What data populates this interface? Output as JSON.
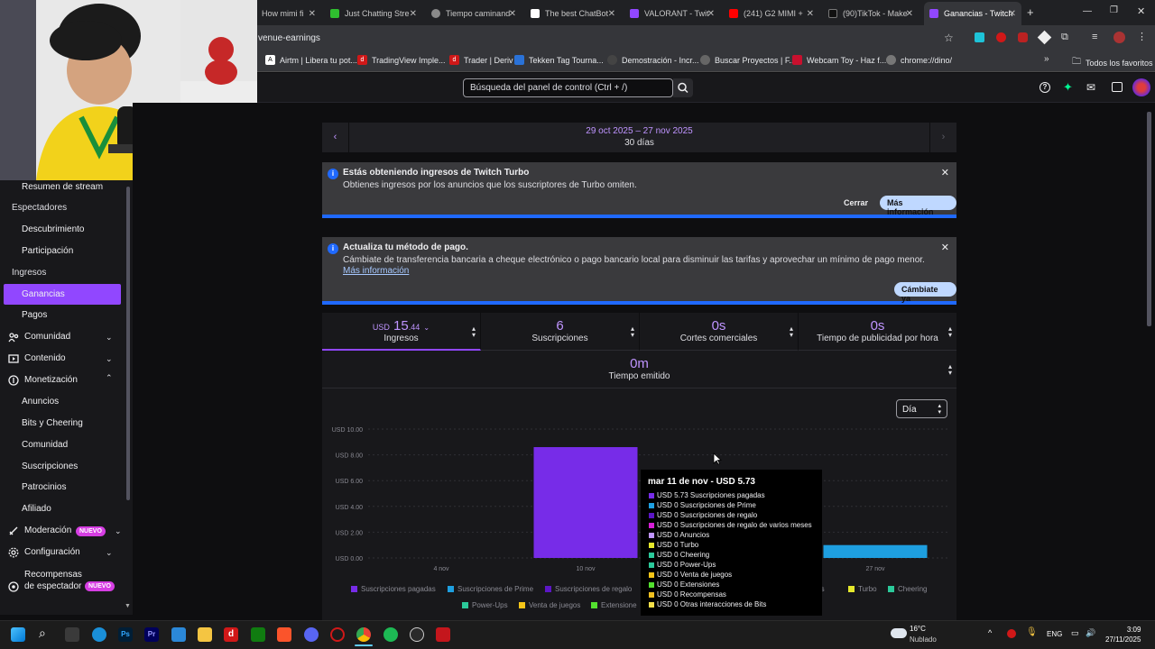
{
  "browser": {
    "tabs": [
      {
        "label": "How mimi fi",
        "color": "#e02020"
      },
      {
        "label": "Just Chatting Stre",
        "color": "#2fbf2f"
      },
      {
        "label": "Tiempo caminand",
        "color": "#8a8a8a"
      },
      {
        "label": "The best ChatBot",
        "color": "#ffffff"
      },
      {
        "label": "VALORANT - Twit",
        "color": "#9147ff"
      },
      {
        "label": "(241) G2 MIMI + ",
        "color": "#ff0000"
      },
      {
        "label": "(90)TikTok - Make",
        "color": "#111111"
      },
      {
        "label": "Ganancias - Twitch",
        "color": "#9147ff"
      }
    ],
    "url": "venue-earnings",
    "bookmarks": [
      {
        "label": "Airtm | Libera tu pot...",
        "color": "#ffffff"
      },
      {
        "label": "TradingView Imple...",
        "color": "#d01818"
      },
      {
        "label": "Trader | Deriv",
        "color": "#d01818"
      },
      {
        "label": "Tekken Tag Tourna...",
        "color": "#2a72d8"
      },
      {
        "label": "Demostración - Incr...",
        "color": "#444444"
      },
      {
        "label": "Buscar Proyectos | F...",
        "color": "#666666"
      },
      {
        "label": "Webcam Toy - Haz f...",
        "color": "#c8102e"
      },
      {
        "label": "chrome://dino/",
        "color": "#777777"
      }
    ],
    "all_bookmarks": "Todos los favoritos"
  },
  "topnav": {
    "search_placeholder": "Búsqueda del panel de control (Ctrl + /)"
  },
  "sidebar": {
    "items": [
      {
        "label": "Resumen de stream"
      },
      {
        "label": "Espectadores"
      },
      {
        "label": "Descubrimiento"
      },
      {
        "label": "Participación"
      },
      {
        "label": "Ingresos"
      },
      {
        "label": "Ganancias"
      },
      {
        "label": "Pagos"
      },
      {
        "label": "Comunidad"
      },
      {
        "label": "Contenido"
      },
      {
        "label": "Monetización"
      },
      {
        "label": "Anuncios"
      },
      {
        "label": "Bits y Cheering"
      },
      {
        "label": "Comunidad"
      },
      {
        "label": "Suscripciones"
      },
      {
        "label": "Patrocinios"
      },
      {
        "label": "Afiliado"
      },
      {
        "label": "Moderación"
      },
      {
        "label": "Configuración"
      },
      {
        "label": "Recompensas de espectador"
      }
    ],
    "badge_new": "NUEVO",
    "accent": "#9147ff"
  },
  "date_range": {
    "range": "29 oct 2025 – 27 nov 2025",
    "days": "30 días"
  },
  "notice_turbo": {
    "title": "Estás obteniendo ingresos de Twitch Turbo",
    "text": "Obtienes ingresos por los anuncios que los suscriptores de Turbo omiten.",
    "close_btn": "Cerrar",
    "more_btn": "Más información"
  },
  "notice_payment": {
    "title": "Actualiza tu método de pago.",
    "text": "Cámbiate de transferencia bancaria a cheque electrónico o pago bancario local para disminuir las tarifas y aprovechar un mínimo de pago menor.",
    "link": "Más información",
    "button": "Cámbiate ya"
  },
  "stats": [
    {
      "currency": "USD",
      "value": "15",
      "cents": ".44",
      "label": "Ingresos"
    },
    {
      "value": "6",
      "label": "Suscripciones"
    },
    {
      "value": "0s",
      "label": "Cortes comerciales"
    },
    {
      "value": "0s",
      "label": "Tiempo de publicidad por hora"
    },
    {
      "value": "0m",
      "label": "Tiempo emitido"
    }
  ],
  "granularity": "Día",
  "chart_data": {
    "type": "bar",
    "x_ticks": [
      "4 nov",
      "10 nov",
      "27 nov"
    ],
    "y_ticks": [
      "USD 0.00",
      "USD 2.00",
      "USD 4.00",
      "USD 6.00",
      "USD 8.00",
      "USD 10.00"
    ],
    "ylim": [
      0,
      10
    ],
    "series": [
      {
        "name": "Suscripciones pagadas",
        "color": "#772ce8",
        "points": [
          {
            "x": "10 nov",
            "y": 8.6
          }
        ]
      },
      {
        "name": "Suscripciones de Prime",
        "color": "#1e9fe0",
        "points": [
          {
            "x": "27 nov",
            "y": 1.0
          }
        ]
      }
    ],
    "legend": [
      {
        "name": "Suscripciones pagadas",
        "color": "#772ce8"
      },
      {
        "name": "Suscripciones de Prime",
        "color": "#1e9fe0"
      },
      {
        "name": "Suscripciones de regalo",
        "color": "#5c16c5"
      },
      {
        "name": "ncios",
        "color": "#1f1f23"
      },
      {
        "name": "Turbo",
        "color": "#e5e82c"
      },
      {
        "name": "Cheering",
        "color": "#2bc99a"
      },
      {
        "name": "Power-Ups",
        "color": "#2bc99a"
      },
      {
        "name": "Venta de juegos",
        "color": "#f5c518"
      },
      {
        "name": "Extensione",
        "color": "#53e02f"
      }
    ],
    "legend_position": "bottom",
    "grid": true
  },
  "tooltip": {
    "title": "mar 11 de nov - USD 5.73",
    "rows": [
      {
        "text": "USD 5.73 Suscripciones pagadas",
        "color": "#772ce8"
      },
      {
        "text": "USD 0 Suscripciones de Prime",
        "color": "#1e9fe0"
      },
      {
        "text": "USD 0 Suscripciones de regalo",
        "color": "#5c16c5"
      },
      {
        "text": "USD 0 Suscripciones de regalo de varios meses",
        "color": "#d61fd6"
      },
      {
        "text": "USD 0 Anuncios",
        "color": "#bf94ff"
      },
      {
        "text": "USD 0 Turbo",
        "color": "#e5e82c"
      },
      {
        "text": "USD 0 Cheering",
        "color": "#2bc99a"
      },
      {
        "text": "USD 0 Power-Ups",
        "color": "#2bc99a"
      },
      {
        "text": "USD 0 Venta de juegos",
        "color": "#f5c518"
      },
      {
        "text": "USD 0 Extensiones",
        "color": "#53e02f"
      },
      {
        "text": "USD 0 Recompensas",
        "color": "#f0c020"
      },
      {
        "text": "USD 0 Otras interacciones de Bits",
        "color": "#f5e04a"
      }
    ]
  },
  "taskbar": {
    "weather_temp": "16°C",
    "weather_text": "Nublado",
    "lang": "ENG",
    "time": "3:09",
    "date": "27/11/2025"
  }
}
